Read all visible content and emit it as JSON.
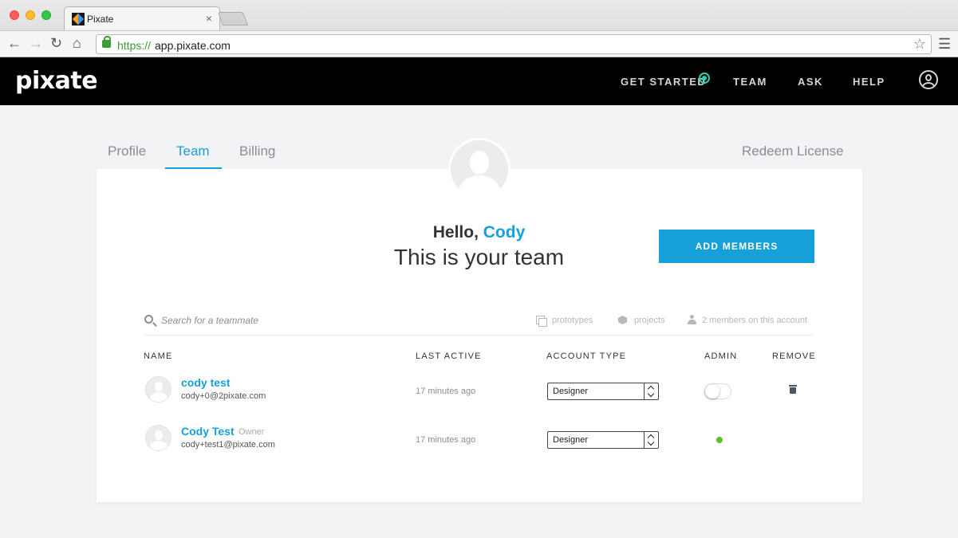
{
  "browser": {
    "tab_title": "Pixate",
    "tab_close": "×",
    "url_scheme": "https://",
    "url_host": "app.pixate.com"
  },
  "header": {
    "logo": "pixate",
    "nav": {
      "get_started": "GET STARTED",
      "team": "TEAM",
      "ask": "ASK",
      "help": "HELP"
    }
  },
  "tabs": {
    "profile": "Profile",
    "team": "Team",
    "billing": "Billing",
    "redeem": "Redeem License"
  },
  "hero": {
    "hello_prefix": "Hello, ",
    "user_name": "Cody",
    "subtitle": "This is your team",
    "add_members": "ADD MEMBERS"
  },
  "search": {
    "placeholder": "Search for a teammate"
  },
  "stats": {
    "prototypes": "prototypes",
    "projects": "projects",
    "members": "2 members on this account"
  },
  "table": {
    "headers": {
      "name": "NAME",
      "last_active": "LAST ACTIVE",
      "account_type": "ACCOUNT TYPE",
      "admin": "ADMIN",
      "remove": "REMOVE"
    },
    "rows": [
      {
        "name": "cody test",
        "role": "",
        "email": "cody+0@2pixate.com",
        "last_active": "17 minutes ago",
        "account_type": "Designer",
        "admin": false
      },
      {
        "name": "Cody Test",
        "role": "Owner",
        "email": "cody+test1@pixate.com",
        "last_active": "17 minutes ago",
        "account_type": "Designer",
        "admin": true
      }
    ]
  },
  "colors": {
    "accent": "#169fd9",
    "header_bg": "#000000",
    "status_green": "#5bc427",
    "get_started_ring": "#2bd3b0"
  }
}
